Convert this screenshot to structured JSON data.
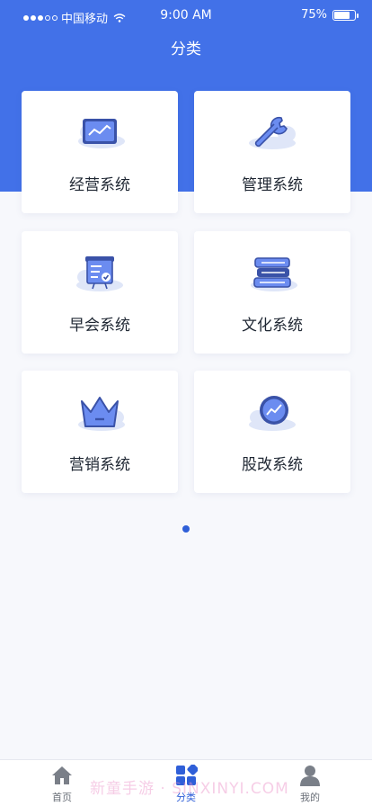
{
  "status_bar": {
    "carrier": "中国移动",
    "time": "9:00 AM",
    "battery": "75%"
  },
  "header": {
    "title": "分类"
  },
  "cards": [
    {
      "label": "经营系统",
      "icon": "monitor-chart-icon"
    },
    {
      "label": "管理系统",
      "icon": "wrench-icon"
    },
    {
      "label": "早会系统",
      "icon": "presentation-board-icon"
    },
    {
      "label": "文化系统",
      "icon": "book-stack-icon"
    },
    {
      "label": "营销系统",
      "icon": "crown-icon"
    },
    {
      "label": "股改系统",
      "icon": "trend-circle-icon"
    }
  ],
  "pager": {
    "active_index": 1,
    "count": 1
  },
  "tab_bar": {
    "items": [
      {
        "label": "首页",
        "icon": "home-icon",
        "active": false
      },
      {
        "label": "分类",
        "icon": "category-icon",
        "active": true
      },
      {
        "label": "我的",
        "icon": "user-icon",
        "active": false
      }
    ]
  },
  "watermark": {
    "text": "新童手游 · SINXINYI.COM"
  },
  "colors": {
    "primary": "#4271e8",
    "accent": "#2f5fd8",
    "icon_light": "#6b8cf0",
    "cloud": "#dfe6f8"
  }
}
